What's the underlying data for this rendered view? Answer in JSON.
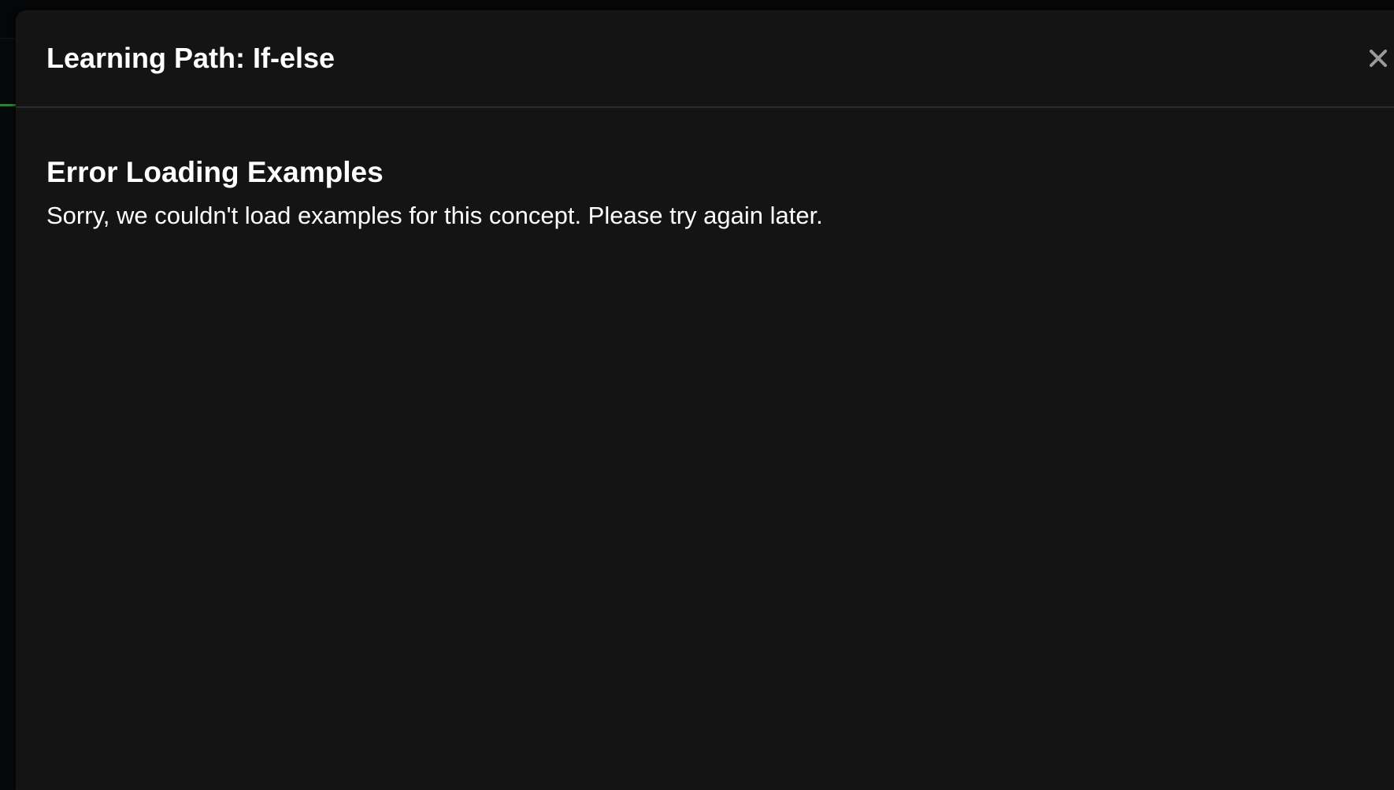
{
  "modal": {
    "title": "Learning Path: If-else",
    "close_icon": "close-icon"
  },
  "error": {
    "title": "Error Loading Examples",
    "message": "Sorry, we couldn't load examples for this concept. Please try again later."
  },
  "colors": {
    "background": "#07080a",
    "modal_background": "#141414",
    "text": "#ffffff",
    "close_icon": "#9a9a9a",
    "divider": "#2b2b2b",
    "accent": "#2f7d3a"
  }
}
